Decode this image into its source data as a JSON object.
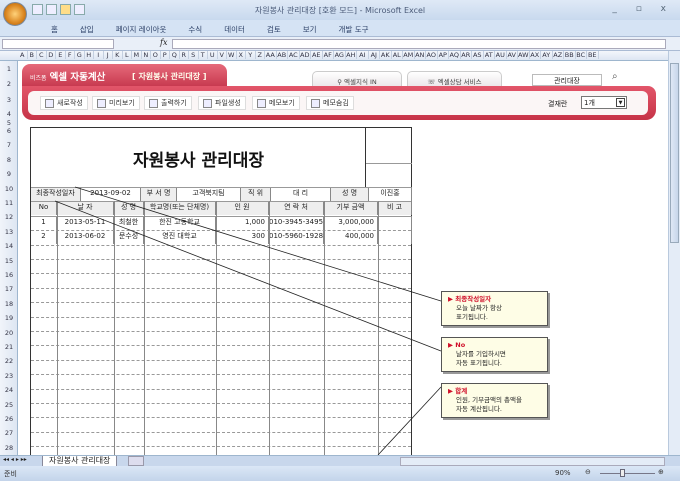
{
  "window": {
    "title": "자원봉사 관리대장 [호환 모드] - Microsoft Excel",
    "controls": "_ ▫ x"
  },
  "ribbon_tabs": [
    "홈",
    "삽입",
    "페이지 레이아웃",
    "수식",
    "데이터",
    "검토",
    "보기",
    "개발 도구"
  ],
  "formula_bar": {
    "fx": "fx",
    "name_box": "",
    "value": ""
  },
  "columns": [
    "A",
    "B",
    "C",
    "D",
    "E",
    "F",
    "G",
    "H",
    "I",
    "J",
    "K",
    "L",
    "M",
    "N",
    "O",
    "P",
    "Q",
    "R",
    "S",
    "T",
    "U",
    "V",
    "W",
    "X",
    "Y",
    "Z",
    "AA",
    "AB",
    "AC",
    "AD",
    "AE",
    "AF",
    "AG",
    "AH",
    "AI",
    "AJ",
    "AK",
    "AL",
    "AM",
    "AN",
    "AO",
    "AP",
    "AQ",
    "AR",
    "AS",
    "AT",
    "AU",
    "AV",
    "AW",
    "AX",
    "AY",
    "AZ",
    "BB",
    "BC",
    "BE"
  ],
  "banner": {
    "brand_small": "비즈폼",
    "brand": "엑셀 자동계산",
    "subtitle": "[ 자원봉사 관리대장 ]",
    "tab1": "엑셀지식 IN",
    "tab2": "엑셀상담 서비스",
    "search_value": "관리대장",
    "toolbar": [
      "새로작성",
      "미리보기",
      "출력하기",
      "파일생성",
      "메모보기",
      "메모숨김"
    ],
    "page_label": "결재란",
    "page_value": "1개"
  },
  "doc": {
    "title": "자원봉사 관리대장",
    "info": [
      "최종작성일자",
      "2013-09-02",
      "부 서 명",
      "고객북지팀",
      "직  위",
      "대 리",
      "성  명",
      "이진홍"
    ],
    "headers": [
      "No",
      "날  자",
      "성  명",
      "학교명(또는 단체명)",
      "인 원",
      "연 락 처",
      "기부 금액",
      "비  고"
    ],
    "rows": [
      [
        "1",
        "2013-05-11",
        "최철한",
        "한진 고등학교",
        "1,000",
        "010-3945-3495",
        "3,000,000",
        ""
      ],
      [
        "2",
        "2013-06-02",
        "문수성",
        "영진 대학교",
        "300",
        "010-5960-1928",
        "400,000",
        ""
      ]
    ]
  },
  "callouts": [
    {
      "title": "최종작성일자",
      "l1": "오늘 날짜가 항상",
      "l2": "표기됩니다."
    },
    {
      "title": "No",
      "l1": "날자를 기입하시면",
      "l2": "자동 표기됩니다."
    },
    {
      "title": "합계",
      "l1": "인원, 기부금액의 총액을",
      "l2": "자동 계산됩니다."
    }
  ],
  "sheet_tab": "자원봉사 관리대장",
  "status": {
    "ready": "준비",
    "zoom": "90%",
    "zoom_level_percent": 90
  }
}
